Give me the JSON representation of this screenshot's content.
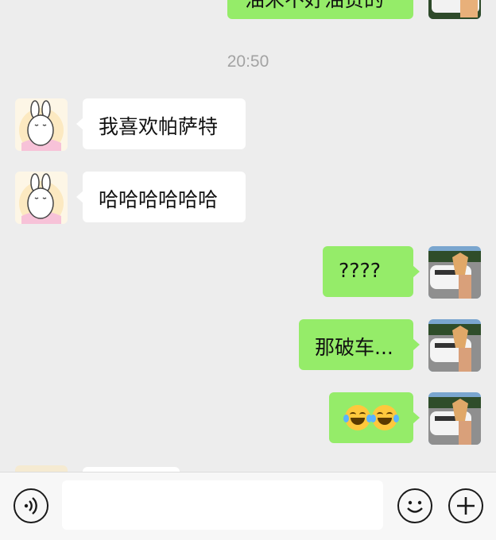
{
  "chat": {
    "top_partial_message": "油米不好油贵的",
    "timestamp": "20:50",
    "messages": [
      {
        "side": "in",
        "text": "我喜欢帕萨特"
      },
      {
        "side": "in",
        "text": "哈哈哈哈哈哈"
      },
      {
        "side": "out",
        "text": "????"
      },
      {
        "side": "out",
        "text": "那破车..."
      },
      {
        "side": "out",
        "text": "😂😂",
        "emoji_names": [
          "face-with-tears-of-joy",
          "face-with-tears-of-joy"
        ]
      }
    ]
  },
  "input_bar": {
    "voice_icon": "voice-icon",
    "message_placeholder": "",
    "emoji_icon": "smiley-icon",
    "more_icon": "plus-icon"
  },
  "colors": {
    "background": "#ededed",
    "outgoing_bubble": "#95ec69",
    "incoming_bubble": "#ffffff",
    "timestamp": "#a3a3a3"
  }
}
